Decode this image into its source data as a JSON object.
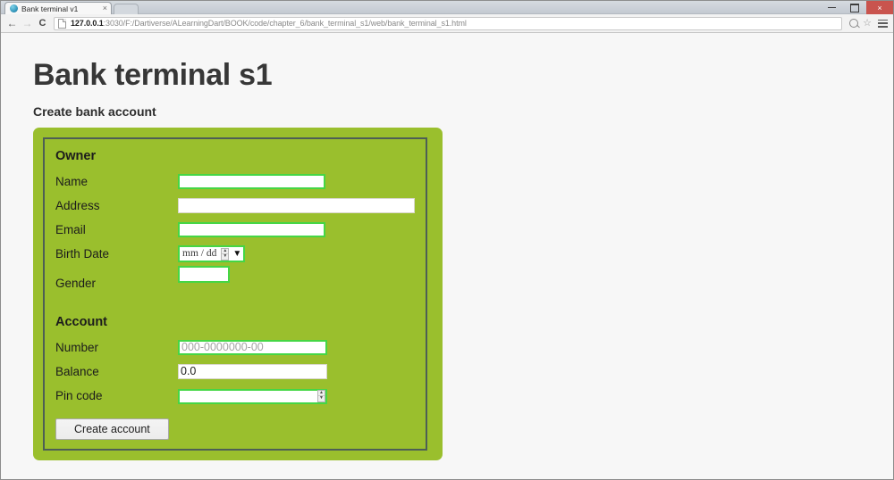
{
  "browser": {
    "tab": {
      "title": "Bank terminal v1",
      "favicon": "globe-icon",
      "close": "×"
    },
    "window_controls": {
      "minimize": "minimize-icon",
      "maximize": "maximize-icon",
      "close": "×"
    },
    "nav": {
      "back": "←",
      "forward": "→",
      "reload": "C"
    },
    "omnibox": {
      "host": "127.0.0.1",
      "path": ":3030/F:/Dartiverse/ALearningDart/BOOK/code/chapter_6/bank_terminal_s1/web/bank_terminal_s1.html",
      "full_url": "127.0.0.1:3030/F:/Dartiverse/ALearningDart/BOOK/code/chapter_6/bank_terminal_s1/web/bank_terminal_s1.html",
      "actions": {
        "zoom": "magnifier-icon",
        "bookmark": "☆",
        "menu": "hamburger-menu-icon"
      }
    }
  },
  "page": {
    "title": "Bank terminal s1",
    "section_title": "Create bank account",
    "colors": {
      "panel_green": "#9abf2d",
      "fieldset_border": "#4d5f55",
      "valid_input_border": "#45d645",
      "page_background": "#f7f7f7"
    },
    "form": {
      "groups": [
        {
          "heading": "Owner",
          "fields": [
            {
              "label": "Name",
              "type": "text",
              "value": "",
              "placeholder": ""
            },
            {
              "label": "Address",
              "type": "text",
              "value": "",
              "placeholder": ""
            },
            {
              "label": "Email",
              "type": "email",
              "value": "",
              "placeholder": ""
            },
            {
              "label": "Birth Date",
              "type": "date",
              "value": "mm / dd",
              "placeholder": "mm / dd"
            },
            {
              "label": "Gender",
              "type": "select",
              "value": "",
              "placeholder": ""
            }
          ]
        },
        {
          "heading": "Account",
          "fields": [
            {
              "label": "Number",
              "type": "text",
              "value": "",
              "placeholder": "000-0000000-00"
            },
            {
              "label": "Balance",
              "type": "text",
              "value": "0.0",
              "placeholder": ""
            },
            {
              "label": "Pin code",
              "type": "number",
              "value": "",
              "placeholder": ""
            }
          ]
        }
      ],
      "submit_label": "Create account"
    }
  }
}
